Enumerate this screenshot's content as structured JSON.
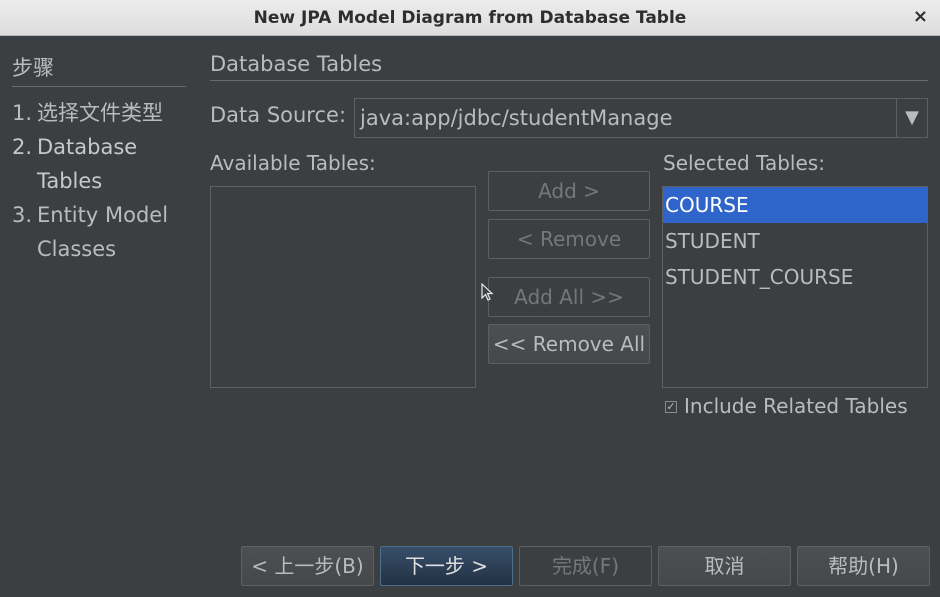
{
  "window": {
    "title": "New JPA Model Diagram from Database Table",
    "close_glyph": "×"
  },
  "steps": {
    "heading": "步骤",
    "items": [
      {
        "num": "1.",
        "label": "选择文件类型"
      },
      {
        "num": "2.",
        "label": "Database Tables"
      },
      {
        "num": "3.",
        "label": "Entity Model Classes"
      }
    ]
  },
  "section": {
    "title": "Database Tables"
  },
  "datasource": {
    "label": "Data Source:",
    "value": "java:app/jdbc/studentManage",
    "arrow_glyph": "▼"
  },
  "available": {
    "label": "Available Tables:",
    "items": []
  },
  "selected": {
    "label": "Selected Tables:",
    "items": [
      "COURSE",
      "STUDENT",
      "STUDENT_COURSE"
    ],
    "selected_index": 0
  },
  "buttons": {
    "add": "Add >",
    "remove": "< Remove",
    "add_all": "Add All >>",
    "remove_all": "<< Remove All"
  },
  "include_related": {
    "label": "Include Related Tables",
    "checked": true,
    "check_glyph": "✓"
  },
  "footer": {
    "back": "< 上一步(B)",
    "next": "下一步 >",
    "finish": "完成(F)",
    "cancel": "取消",
    "help": "帮助(H)"
  },
  "colors": {
    "background": "#3c3f41",
    "selection": "#2f65ca",
    "primary_button": "#2c3e54"
  }
}
